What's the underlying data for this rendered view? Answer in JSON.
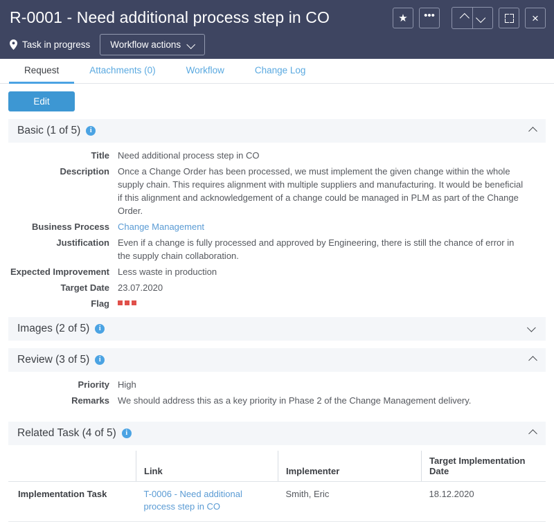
{
  "header": {
    "title": "R-0001 - Need additional process step in CO",
    "status_text": "Task in progress",
    "status_icon": "location-pin-icon",
    "workflow_button": "Workflow actions",
    "buttons": {
      "favorite": "★",
      "more": "•••",
      "previous": "prev-chevron-up-icon",
      "next": "next-chevron-down-icon",
      "maximize": "expand-icon",
      "close": "×"
    },
    "background_color": "#3e4561"
  },
  "tabs": [
    {
      "label": "Request",
      "active": true
    },
    {
      "label": "Attachments (0)",
      "active": false
    },
    {
      "label": "Workflow",
      "active": false
    },
    {
      "label": "Change Log",
      "active": false
    }
  ],
  "toolbar": {
    "edit_label": "Edit",
    "edit_color": "#3d97d3"
  },
  "sections": {
    "basic": {
      "title": "Basic (1 of 5)",
      "expanded": true,
      "fields": [
        {
          "label": "Title",
          "value": "Need additional process step in CO"
        },
        {
          "label": "Description",
          "value": "Once a Change Order has been processed, we must implement the given change within the whole supply chain. This requires alignment with multiple suppliers and manufacturing. It would be beneficial if this alignment and acknowledgement of a change could be managed in PLM as part of the Change Order."
        },
        {
          "label": "Business Process",
          "value": "Change Management"
        },
        {
          "label": "Justification",
          "value": "Even if a change is fully processed and approved by Engineering, there is still the chance of error in the supply chain collaboration."
        },
        {
          "label": "Expected Improvement",
          "value": "Less waste in production"
        },
        {
          "label": "Target Date",
          "value": "23.07.2020"
        },
        {
          "label": "Flag",
          "value": "",
          "flag_count": 3,
          "flag_color": "#e0504a"
        }
      ]
    },
    "images": {
      "title": "Images (2 of 5)",
      "expanded": false
    },
    "review": {
      "title": "Review (3 of 5)",
      "expanded": true,
      "fields": [
        {
          "label": "Priority",
          "value": "High"
        },
        {
          "label": "Remarks",
          "value": "We should address this as a key priority in Phase 2 of the Change Management delivery."
        }
      ]
    },
    "related_task": {
      "title": "Related Task (4 of 5)",
      "expanded": true,
      "columns": [
        "",
        "Link",
        "Implementer",
        "Target Implementation Date"
      ],
      "rows": [
        {
          "label": "Implementation Task",
          "link": "T-0006 - Need additional process step in CO",
          "implementer": "Smith, Eric",
          "target_date": "18.12.2020"
        }
      ]
    }
  },
  "colors": {
    "accent_blue": "#4ba3e3",
    "link_blue": "#5a9bd4",
    "section_bg": "#f4f6f9",
    "flag_red": "#e0504a"
  }
}
